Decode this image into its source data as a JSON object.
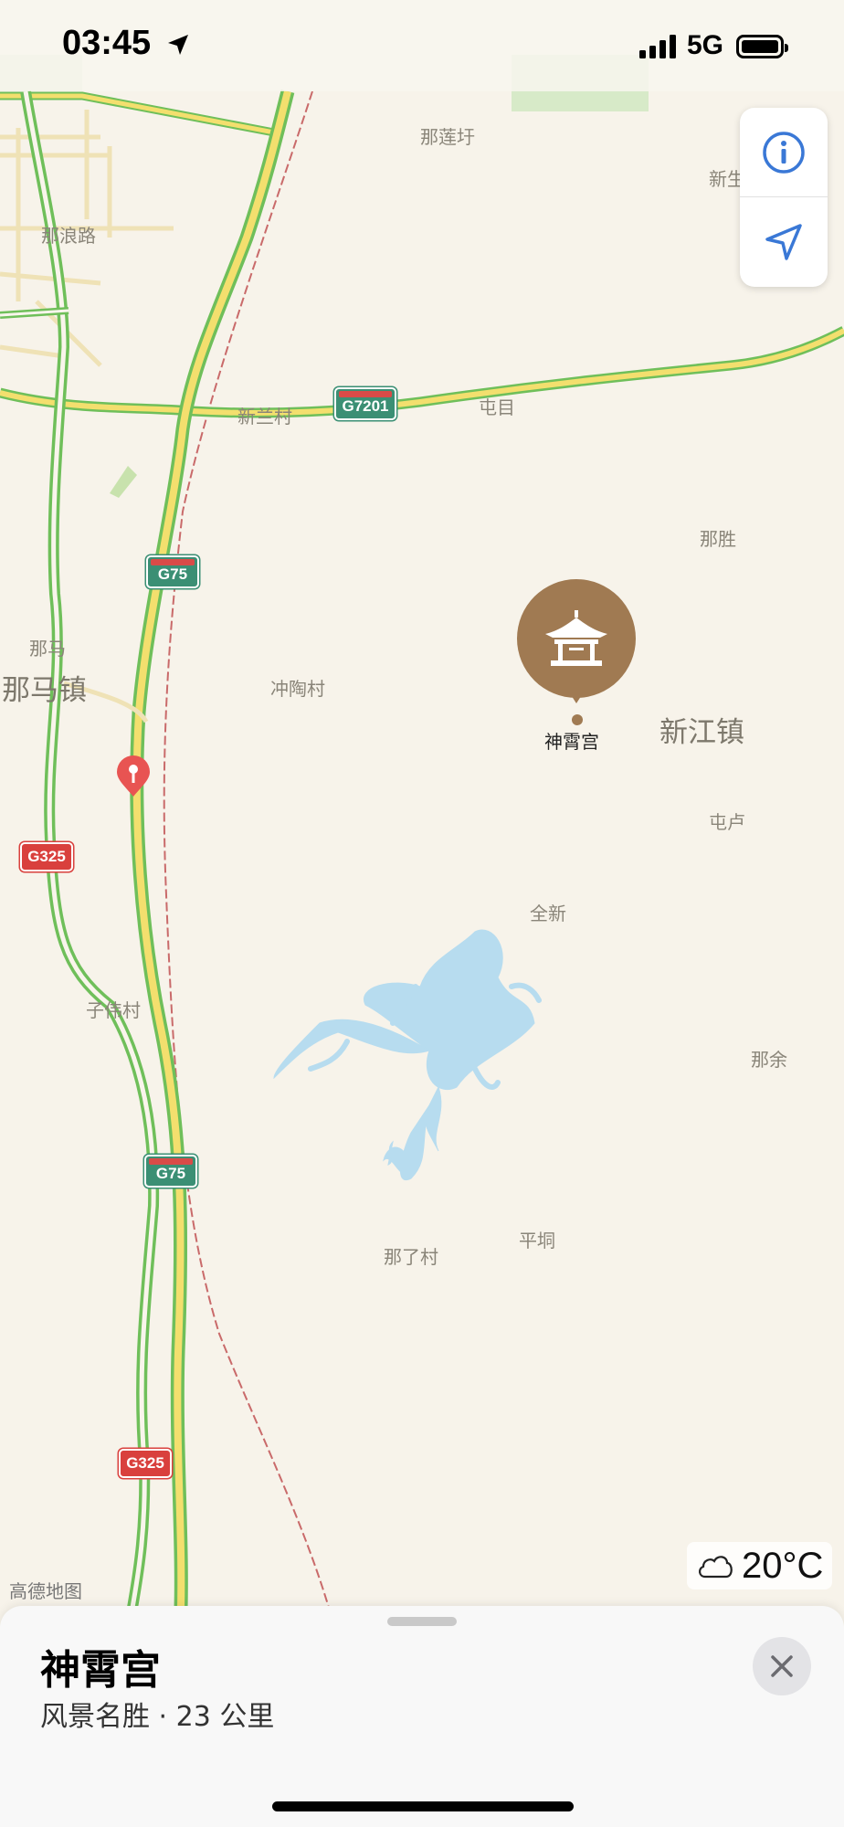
{
  "status_bar": {
    "time": "03:45",
    "network": "5G"
  },
  "map": {
    "labels": [
      {
        "text": "那莲圩",
        "key": "nalianwei"
      },
      {
        "text": "新生",
        "key": "xinsheng"
      },
      {
        "text": "那浪路",
        "key": "nalanglu"
      },
      {
        "text": "新兰村",
        "key": "xinlancun"
      },
      {
        "text": "屯目",
        "key": "tunmu"
      },
      {
        "text": "那胜",
        "key": "nasheng"
      },
      {
        "text": "那马",
        "key": "nama"
      },
      {
        "text": "那马镇",
        "key": "namazhen"
      },
      {
        "text": "冲陶村",
        "key": "chongtaocun"
      },
      {
        "text": "新江镇",
        "key": "xinjiangzhen"
      },
      {
        "text": "屯卢",
        "key": "tunlu"
      },
      {
        "text": "全新",
        "key": "quanxin"
      },
      {
        "text": "子伟村",
        "key": "ziweicun"
      },
      {
        "text": "那余",
        "key": "nayu"
      },
      {
        "text": "那了村",
        "key": "naliaocun"
      },
      {
        "text": "平垌",
        "key": "pingdong"
      }
    ],
    "shields": {
      "g7201": "G7201",
      "g75_top": "G75",
      "g75_bottom": "G75",
      "g325_top": "G325",
      "g325_bottom": "G325"
    },
    "poi": {
      "name": "神霄宫",
      "color": "#a07a52",
      "icon": "pavilion-icon"
    },
    "watermark": "高德地图"
  },
  "weather": {
    "temperature": "20°C",
    "icon": "cloud-icon"
  },
  "place_sheet": {
    "title": "神霄宫",
    "subtitle": "风景名胜 · 23 公里"
  },
  "colors": {
    "highway": "#f3df6e",
    "highway_edge": "#6fbf5a",
    "water": "#b7dcef",
    "railway": "#c96a6a",
    "land": "#f7f3ea"
  }
}
